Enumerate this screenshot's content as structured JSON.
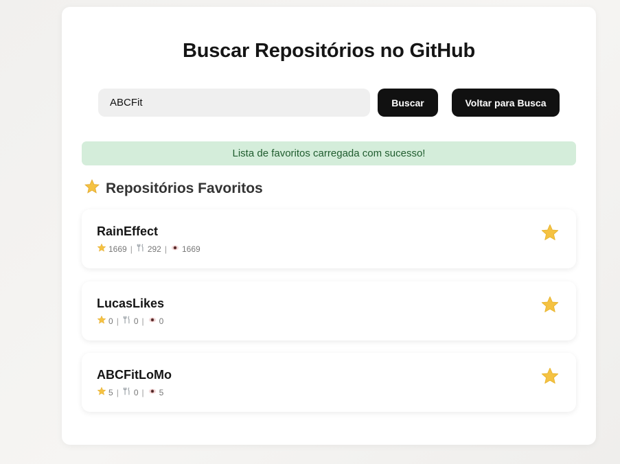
{
  "header": {
    "title": "Buscar Repositórios no GitHub"
  },
  "search": {
    "value": "ABCFit",
    "button_label": "Buscar",
    "back_label": "Voltar para Busca"
  },
  "alert": {
    "message": "Lista de favoritos carregada com sucesso!"
  },
  "favorites": {
    "title": "Repositórios Favoritos",
    "items": [
      {
        "name": "RainEffect",
        "stars": "1669",
        "forks": "292",
        "watchers": "1669"
      },
      {
        "name": "LucasLikes",
        "stars": "0",
        "forks": "0",
        "watchers": "0"
      },
      {
        "name": "ABCFitLoMo",
        "stars": "5",
        "forks": "0",
        "watchers": "5"
      }
    ]
  },
  "colors": {
    "accent": "#111111",
    "alert_bg": "#d4edda",
    "alert_text": "#1f5c2e",
    "star": "#f5c242"
  },
  "icons": [
    "star-icon",
    "fork-icon",
    "eye-icon",
    "favorite-star-icon"
  ]
}
